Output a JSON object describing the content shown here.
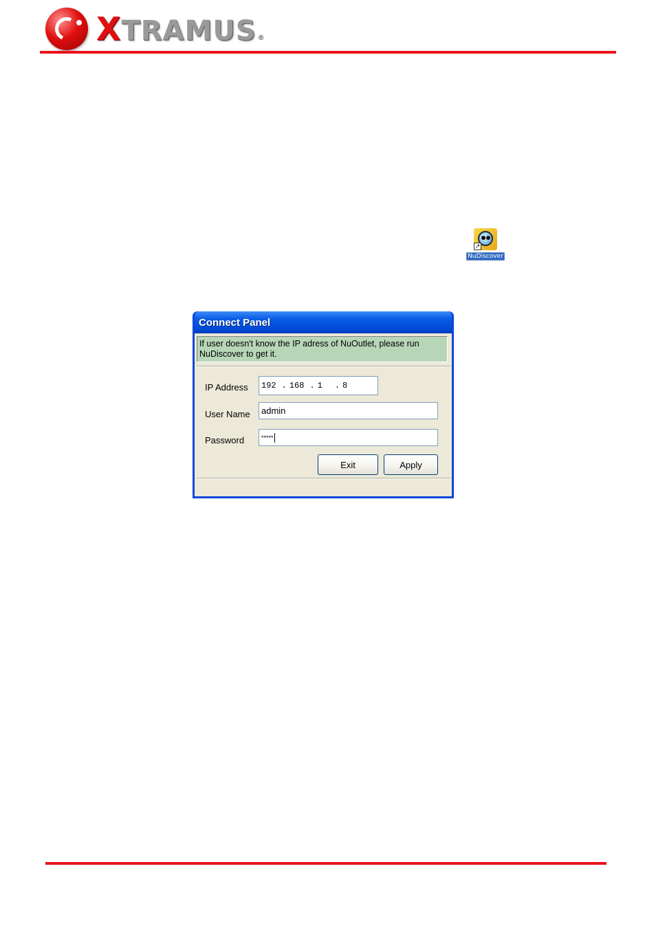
{
  "header": {
    "logo_first_letter": "X",
    "logo_rest": "TRAMUS",
    "logo_reg": "®",
    "rule_color": "#e8141c"
  },
  "shortcut": {
    "label": "NuDiscover",
    "icon": "nudiscover-icon"
  },
  "dialog": {
    "title": "Connect Panel",
    "notice": "If user doesn't know the IP adress of NuOutlet, please run NuDiscover to get it.",
    "ip": {
      "label": "IP Address",
      "octets": [
        "192",
        "168",
        "1",
        "8"
      ]
    },
    "username": {
      "label": "User Name",
      "value": "admin"
    },
    "password": {
      "label": "Password",
      "value": "*****"
    },
    "buttons": {
      "exit": "Exit",
      "apply": "Apply"
    },
    "title_color": "#0a5ce6",
    "notice_color": "#b7d6b7"
  }
}
